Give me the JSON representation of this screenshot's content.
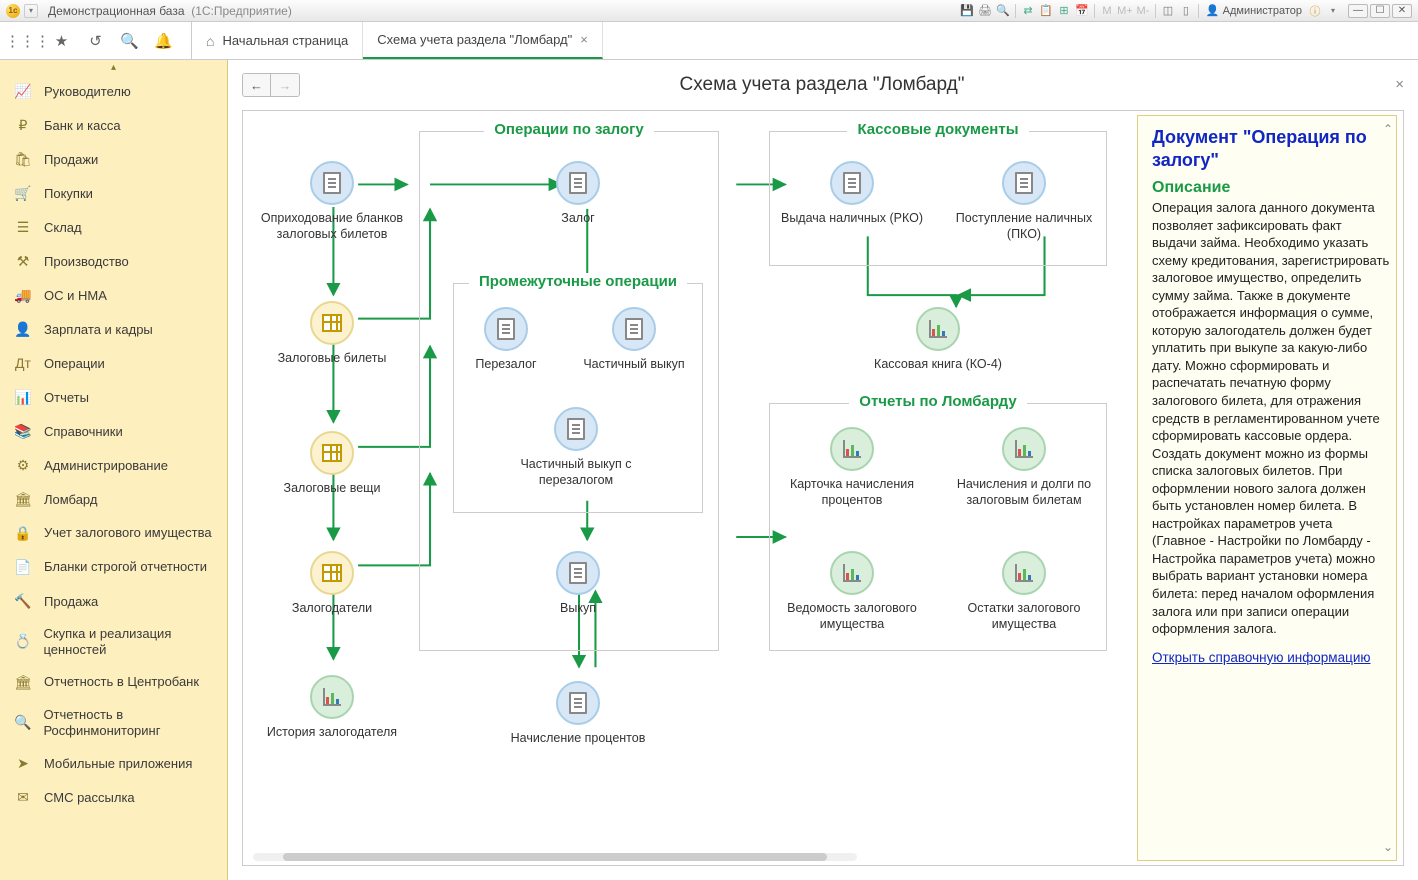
{
  "titlebar": {
    "title": "Демонстрационная база",
    "product": "(1С:Предприятие)",
    "user_label": "Администратор",
    "m": "M",
    "mplus": "M+",
    "mminus": "M-"
  },
  "tabs": {
    "home": "Начальная страница",
    "active": "Схема учета раздела \"Ломбард\""
  },
  "main": {
    "title": "Схема учета раздела \"Ломбард\""
  },
  "sidebar": [
    {
      "id": "manager",
      "label": "Руководителю",
      "icon": "📈"
    },
    {
      "id": "bank",
      "label": "Банк и касса",
      "icon": "₽"
    },
    {
      "id": "sales",
      "label": "Продажи",
      "icon": "🛍"
    },
    {
      "id": "purchase",
      "label": "Покупки",
      "icon": "🛒"
    },
    {
      "id": "stock",
      "label": "Склад",
      "icon": "☰"
    },
    {
      "id": "production",
      "label": "Производство",
      "icon": "⚒"
    },
    {
      "id": "osnma",
      "label": "ОС и НМА",
      "icon": "🚚"
    },
    {
      "id": "hr",
      "label": "Зарплата и кадры",
      "icon": "👤"
    },
    {
      "id": "ops",
      "label": "Операции",
      "icon": "Дт"
    },
    {
      "id": "reports",
      "label": "Отчеты",
      "icon": "📊"
    },
    {
      "id": "refs",
      "label": "Справочники",
      "icon": "📚"
    },
    {
      "id": "admin",
      "label": "Администрирование",
      "icon": "⚙"
    },
    {
      "id": "lombard",
      "label": "Ломбард",
      "icon": "🏛"
    },
    {
      "id": "pledge-acc",
      "label": "Учет залогового имущества",
      "icon": "🔒"
    },
    {
      "id": "blanks",
      "label": "Бланки строгой отчетности",
      "icon": "📄"
    },
    {
      "id": "sale",
      "label": "Продажа",
      "icon": "🔨"
    },
    {
      "id": "skupka",
      "label": "Скупка и реализация ценностей",
      "icon": "💍"
    },
    {
      "id": "cb",
      "label": "Отчетность в Центробанк",
      "icon": "🏛"
    },
    {
      "id": "rosfin",
      "label": "Отчетность в Росфинмониторинг",
      "icon": "🔍"
    },
    {
      "id": "mobile",
      "label": "Мобильные приложения",
      "icon": "➤"
    },
    {
      "id": "sms",
      "label": "СМС рассылка",
      "icon": "✉"
    }
  ],
  "groups": {
    "pledge_ops": "Операции по залогу",
    "intermediate": "Промежуточные операции",
    "cash_docs": "Кассовые документы",
    "lombard_reports": "Отчеты по Ломбарду"
  },
  "nodes": {
    "oprih": "Оприходование бланков залоговых билетов",
    "tickets": "Залоговые билеты",
    "items": "Залоговые вещи",
    "pledgers": "Залогодатели",
    "history": "История залогодателя",
    "zalog": "Залог",
    "perezalog": "Перезалог",
    "partial": "Частичный выкуп",
    "partial_pere": "Частичный выкуп с перезалогом",
    "vykup": "Выкуп",
    "interest": "Начисление процентов",
    "rko": "Выдача наличных (РКО)",
    "pko": "Поступление наличных (ПКО)",
    "kassbook": "Кассовая книга (КО-4)",
    "card": "Карточка начисления процентов",
    "debts": "Начисления и долги по залоговым билетам",
    "inventory": "Ведомость залогового имущества",
    "remains": "Остатки залогового имущества"
  },
  "help": {
    "title": "Документ \"Операция по залогу\"",
    "subtitle": "Описание",
    "body": "Операция залога данного документа позволяет зафиксировать факт выдачи займа. Необходимо указать схему кредитования, зарегистрировать залоговое имущество, определить сумму займа. Также в документе отображается информация о сумме, которую залогодатель должен будет уплатить при выкупе за какую-либо дату. Можно сформировать и распечатать печатную форму залогового билета, для отражения средств в регламентированном учете сформировать кассовые ордера. Создать документ можно из формы списка залоговых билетов. При оформлении нового залога должен быть установлен номер билета. В настройках параметров учета (Главное - Настройки по Ломбарду - Настройка параметров учета) можно выбрать вариант установки номера билета: перед началом оформления залога или при записи операции оформления залога.",
    "link": "Открыть справочную информацию"
  }
}
